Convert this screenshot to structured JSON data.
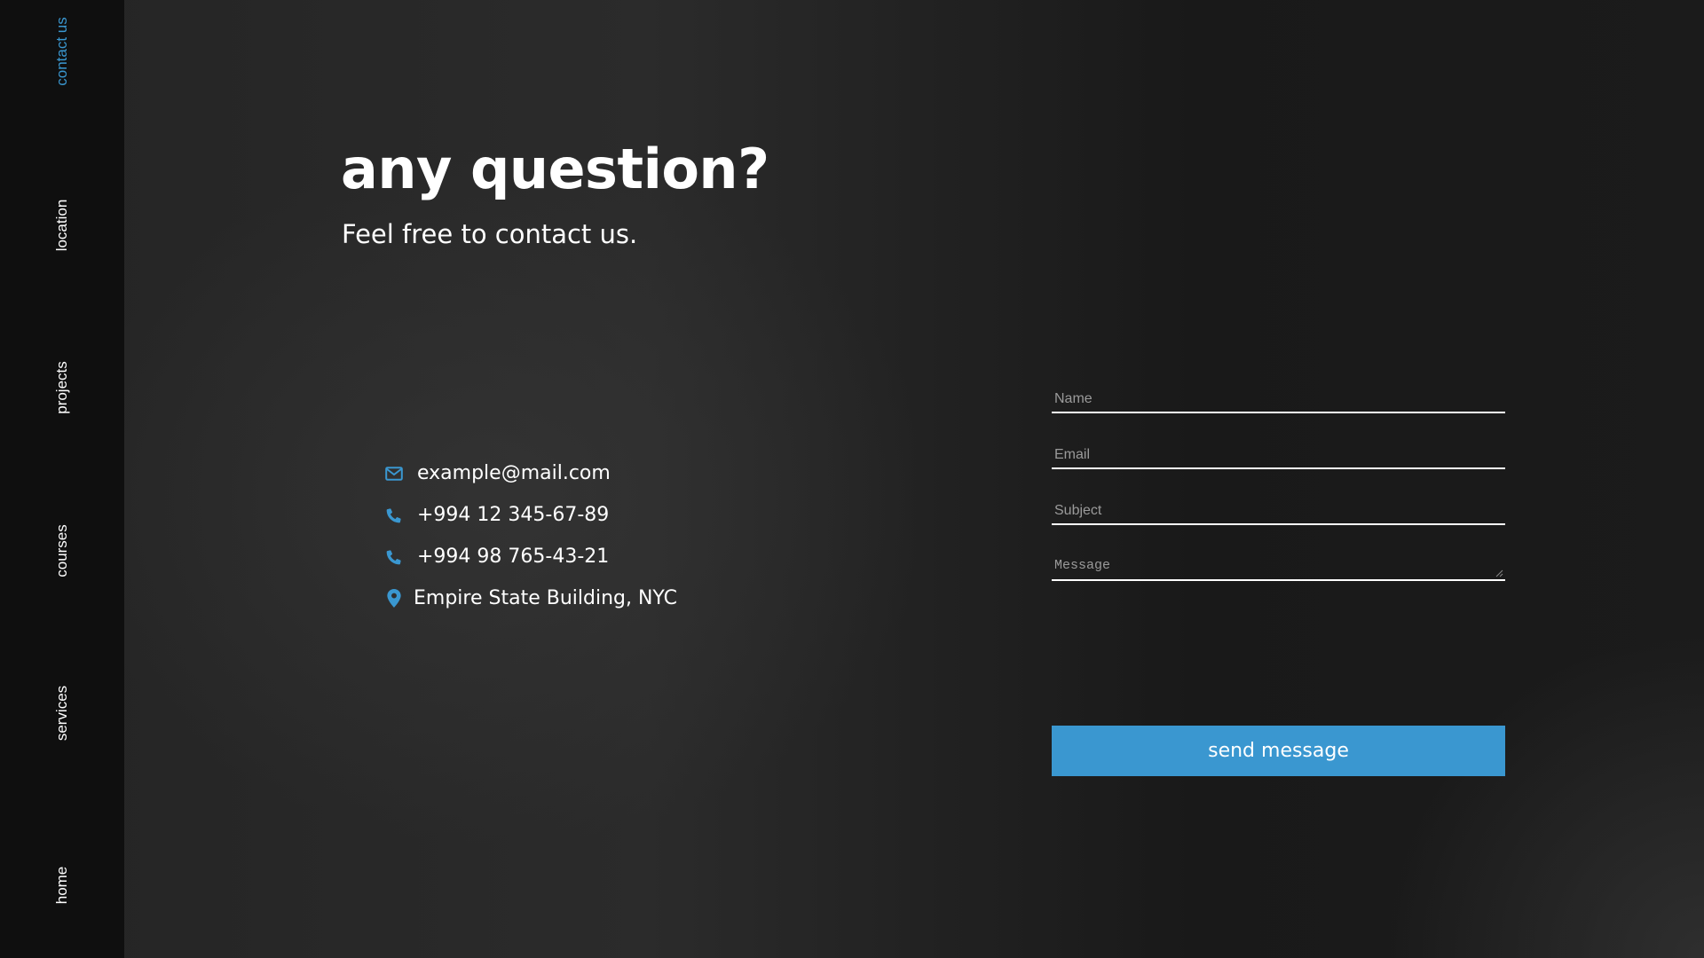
{
  "sidebar": {
    "items": [
      {
        "label": "contact us",
        "active": true
      },
      {
        "label": "location",
        "active": false
      },
      {
        "label": "projects",
        "active": false
      },
      {
        "label": "courses",
        "active": false
      },
      {
        "label": "services",
        "active": false
      },
      {
        "label": "home",
        "active": false
      }
    ]
  },
  "hero": {
    "title": "any question?",
    "subtitle": "Feel free to contact us."
  },
  "contact": {
    "items": [
      {
        "icon": "envelope-icon",
        "text": "example@mail.com"
      },
      {
        "icon": "phone-icon",
        "text": "+994 12 345-67-89"
      },
      {
        "icon": "phone-icon",
        "text": "+994 98 765-43-21"
      },
      {
        "icon": "map-pin-icon",
        "text": "Empire State Building, NYC"
      }
    ]
  },
  "form": {
    "name_placeholder": "Name",
    "email_placeholder": "Email",
    "subject_placeholder": "Subject",
    "message_placeholder": "Message",
    "submit_label": "send message"
  },
  "colors": {
    "accent": "#3a97d0",
    "sidebar_bg": "#0f0f0f",
    "text": "#ffffff"
  }
}
